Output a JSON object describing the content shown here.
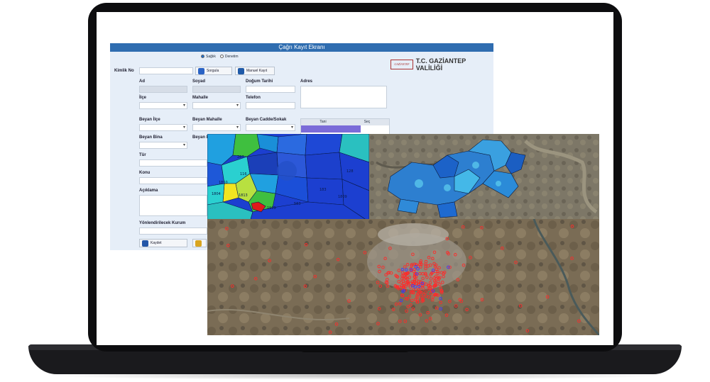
{
  "app": {
    "title": "Çağrı Kayıt Ekranı",
    "radio_options": [
      {
        "label": "Sağlık",
        "selected": true
      },
      {
        "label": "Denetim",
        "selected": false
      }
    ],
    "logo_badge": "GAZİANTEP",
    "logo_text": "T.C. GAZİANTEP VALİLİĞİ"
  },
  "form": {
    "kimlik_no_label": "Kimlik No",
    "sorgula_label": "Sorgula",
    "manuel_kayit_label": "Manuel Kayıt",
    "ad_label": "Ad",
    "soyad_label": "Soyad",
    "dogum_tarihi_label": "Doğum Tarihi",
    "adres_label": "Adres",
    "ilce_label": "İlçe",
    "mahalle_label": "Mahalle",
    "telefon_label": "Telefon",
    "beyan_ilce_label": "Beyan İlçe",
    "beyan_mahalle_label": "Beyan Mahalle",
    "beyan_cadde_label": "Beyan Cadde/Sokak",
    "beyan_bina_label": "Beyan Bina",
    "beyan_d_label": "Beyan D",
    "tur_label": "Tür",
    "konu_label": "Konu",
    "aciklama_label": "Açıklama",
    "yonlendirilecek_label": "Yönlendirilecek Kurum",
    "kaydet_label": "Kaydet",
    "table_col1": "Tani",
    "table_col2": "Seç"
  },
  "map_labels": [
    "267",
    "116",
    "1813",
    "1969",
    "183",
    "583",
    "1804",
    "1810",
    "128",
    "1809"
  ],
  "colors": {
    "accent": "#2f6db0",
    "choropleth_blue": "#1c3fd0",
    "choropleth_green": "#3fbf3f",
    "choropleth_yellow": "#f2e520",
    "choropleth_red": "#e01a1a",
    "point_red": "#ff2a2a",
    "point_blue": "#3a3aff"
  }
}
